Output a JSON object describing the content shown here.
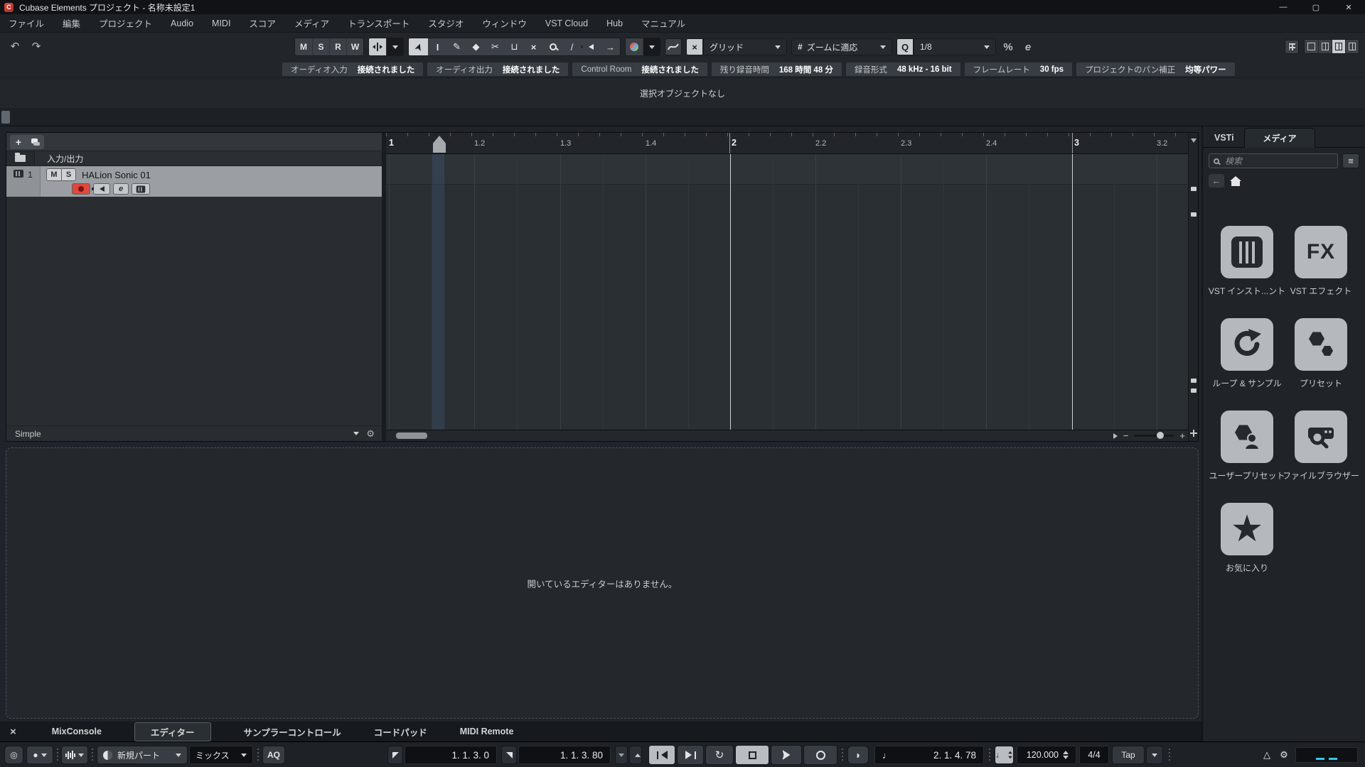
{
  "window": {
    "title": "Cubase Elements プロジェクト - 名称未設定1",
    "logo_letter": "C",
    "minimize_glyph": "—",
    "maximize_glyph": "▢",
    "close_glyph": "✕"
  },
  "menu": {
    "items": [
      "ファイル",
      "編集",
      "プロジェクト",
      "Audio",
      "MIDI",
      "スコア",
      "メディア",
      "トランスポート",
      "スタジオ",
      "ウィンドウ",
      "VST Cloud",
      "Hub",
      "マニュアル"
    ]
  },
  "toolbar": {
    "undo_glyph": "↶",
    "redo_glyph": "↷",
    "automation": [
      "M",
      "S",
      "R",
      "W"
    ],
    "grid_label": "グリッド",
    "zoom_preset_label": "ズームに適応",
    "zoom_hash_glyph": "#",
    "quantize_q_glyph": "Q",
    "quantize_value": "1/8",
    "iterative_quantize_glyph": "%",
    "quantize_panel_glyph": "e",
    "snap_glyph": "×",
    "tool_glyphs": {
      "select": "➤",
      "range": "I",
      "draw": "✎",
      "erase": "◆",
      "split": "✂",
      "glue": "⊔",
      "mute": "×",
      "line": "/",
      "feedback": "→"
    },
    "icons": [
      "undo-icon",
      "redo-icon",
      "autoscroll-icon",
      "object-selection-tool",
      "range-tool",
      "draw-tool",
      "erase-tool",
      "split-tool",
      "glue-tool",
      "mute-tool",
      "zoom-tool",
      "line-tool",
      "play-tool",
      "feedback-icon",
      "color-menu-icon",
      "automation-curve-icon",
      "snap-icon",
      "window-zones-icon",
      "layout-pane-icons"
    ]
  },
  "infoline": {
    "items": [
      {
        "label": "オーディオ入力",
        "value": "接続されました"
      },
      {
        "label": "オーディオ出力",
        "value": "接続されました"
      },
      {
        "label": "Control Room",
        "value": "接続されました"
      },
      {
        "label": "残り録音時間",
        "value": "168 時間 48 分"
      },
      {
        "label": "録音形式",
        "value": "48 kHz - 16 bit"
      },
      {
        "label": "フレームレート",
        "value": "30 fps"
      },
      {
        "label": "プロジェクトのパン補正",
        "value": "均等パワー"
      }
    ]
  },
  "status_line": "選択オブジェクトなし",
  "project": {
    "add_track_glyph": "+",
    "io_label": "入力/出力",
    "track": {
      "number": "1",
      "mute": "M",
      "solo": "S",
      "name": "HALion Sonic 01",
      "edit_glyph": "e"
    },
    "footer_label": "Simple"
  },
  "ruler": {
    "ticks": [
      "1",
      "1.2",
      "1.3",
      "1.4",
      "2",
      "2.2",
      "2.3",
      "2.4",
      "3",
      "3.2"
    ]
  },
  "right_panel": {
    "tabs": [
      "VSTi",
      "メディア"
    ],
    "active_tab": "メディア",
    "search_placeholder": "検索",
    "back_glyph": "←",
    "list_glyph": "≡",
    "fx_text": "FX",
    "tiles": [
      {
        "label": "VST インスト...ント",
        "icon": "vst-instruments-icon"
      },
      {
        "label": "VST エフェクト",
        "icon": "vst-effects-icon"
      },
      {
        "label": "ループ & サンプル",
        "icon": "loops-samples-icon"
      },
      {
        "label": "プリセット",
        "icon": "presets-icon"
      },
      {
        "label": "ユーザープリセット",
        "icon": "user-presets-icon"
      },
      {
        "label": "ファイルブラウザー",
        "icon": "file-browser-icon"
      },
      {
        "label": "お気に入り",
        "icon": "favorites-icon"
      }
    ],
    "star_glyph": "★"
  },
  "lower_zone": {
    "message": "開いているエディターはありません。"
  },
  "bottom_tabs": {
    "close_glyph": "×",
    "tabs": [
      "MixConsole",
      "エディター",
      "サンプラーコントロール",
      "コードパッド",
      "MIDI Remote"
    ],
    "active": "エディター"
  },
  "transport": {
    "record_modes_glyph": "◎",
    "part_label": "新規パート",
    "mix_label": "ミックス",
    "aq_label": "AQ",
    "left_locator": "1. 1. 3.  0",
    "right_locator": "1. 1. 3. 80",
    "cycle_glyph": "↻",
    "time_note_glyph": "♩",
    "time_value": "2. 1. 4. 78",
    "preroll_glyph": "◗",
    "click_glyph": "♩",
    "tempo": "120.000",
    "timesig": "4/4",
    "tap_label": "Tap",
    "metronome_glyph": "△",
    "gear_glyph": "⚙"
  }
}
